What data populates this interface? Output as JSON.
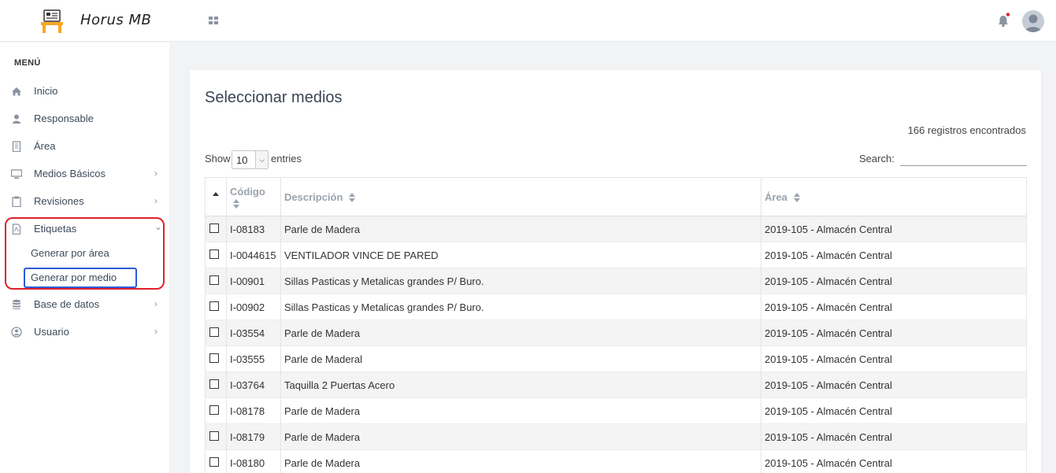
{
  "app": {
    "title": "Horus MB"
  },
  "sidebar": {
    "heading": "MENÚ",
    "items": [
      {
        "label": "Inicio",
        "icon": "home-icon"
      },
      {
        "label": "Responsable",
        "icon": "user-icon"
      },
      {
        "label": "Área",
        "icon": "building-icon"
      },
      {
        "label": "Medios Básicos",
        "icon": "monitor-icon"
      },
      {
        "label": "Revisiones",
        "icon": "clipboard-icon"
      },
      {
        "label": "Etiquetas",
        "icon": "pdf-file-icon"
      },
      {
        "label": "Base de datos",
        "icon": "database-icon"
      },
      {
        "label": "Usuario",
        "icon": "user-circle-icon"
      }
    ],
    "sub_items": [
      {
        "label": "Generar por área"
      },
      {
        "label": "Generar por medio"
      }
    ]
  },
  "main": {
    "title": "Seleccionar medios",
    "records_text": "166 registros encontrados",
    "show_label": "Show",
    "show_value": "10",
    "entries_label": "entries",
    "search_label": "Search:",
    "search_value": "",
    "columns": [
      "Código",
      "Descripción",
      "Área"
    ],
    "rows": [
      {
        "codigo": "I-08183",
        "descripcion": "Parle de Madera",
        "area": "2019-105 - Almacén Central"
      },
      {
        "codigo": "I-0044615",
        "descripcion": "VENTILADOR VINCE DE PARED",
        "area": "2019-105 - Almacén Central"
      },
      {
        "codigo": "I-00901",
        "descripcion": "Sillas Pasticas y Metalicas grandes P/ Buro.",
        "area": "2019-105 - Almacén Central"
      },
      {
        "codigo": "I-00902",
        "descripcion": "Sillas Pasticas y Metalicas grandes P/ Buro.",
        "area": "2019-105 - Almacén Central"
      },
      {
        "codigo": "I-03554",
        "descripcion": "Parle de Madera",
        "area": "2019-105 - Almacén Central"
      },
      {
        "codigo": "I-03555",
        "descripcion": "Parle de Maderal",
        "area": "2019-105 - Almacén Central"
      },
      {
        "codigo": "I-03764",
        "descripcion": "Taquilla 2 Puertas Acero",
        "area": "2019-105 - Almacén Central"
      },
      {
        "codigo": "I-08178",
        "descripcion": "Parle de Madera",
        "area": "2019-105 - Almacén Central"
      },
      {
        "codigo": "I-08179",
        "descripcion": "Parle de Madera",
        "area": "2019-105 - Almacén Central"
      },
      {
        "codigo": "I-08180",
        "descripcion": "Parle de Madera",
        "area": "2019-105 - Almacén Central"
      }
    ]
  },
  "colors": {
    "highlight_red": "#e0202a",
    "highlight_blue": "#2b5bd8",
    "logo_orange": "#f5a623",
    "notification_dot": "#e0202a"
  }
}
